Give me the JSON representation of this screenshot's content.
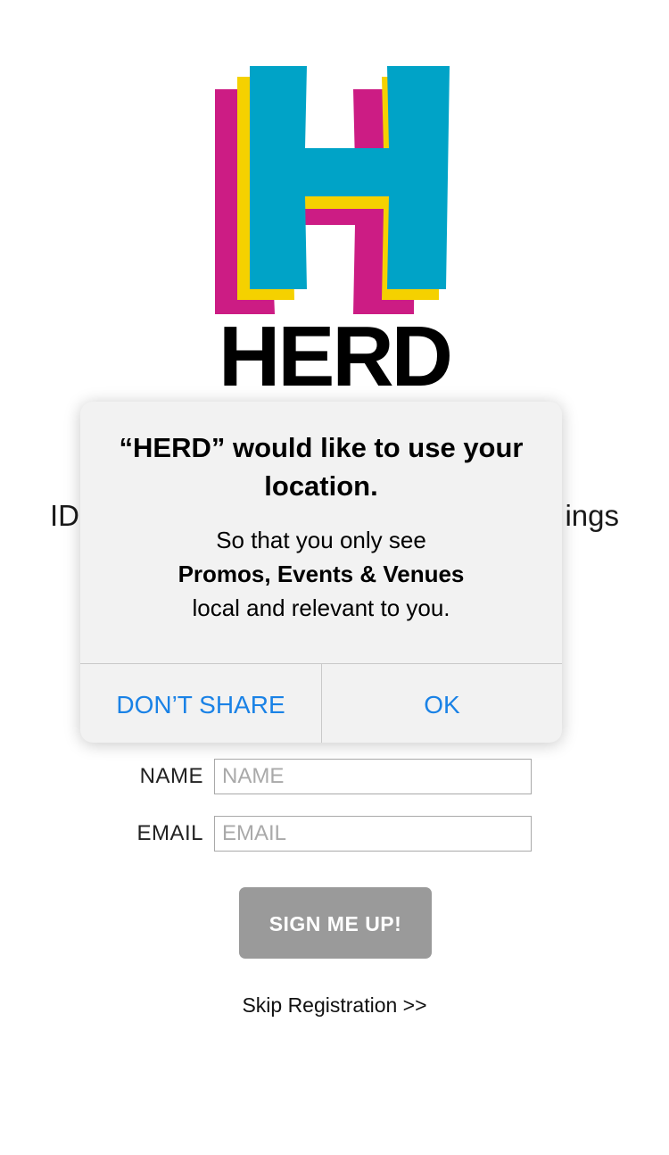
{
  "app": {
    "wordmark": "HERD",
    "logo_icon": "herd-h-logo",
    "brand_colors": {
      "magenta": "#cc1c84",
      "yellow": "#f5d100",
      "cyan": "#00a3c7"
    }
  },
  "tagline": {
    "left_fragment": "ID",
    "right_fragment": "ings"
  },
  "form": {
    "name_label": "NAME",
    "name_placeholder": "NAME",
    "name_value": "",
    "email_label": "EMAIL",
    "email_placeholder": "EMAIL",
    "email_value": "",
    "signup_label": "SIGN ME UP!",
    "signup_color": "#9a9a9a",
    "skip_label": "Skip Registration >>"
  },
  "alert": {
    "title": "“HERD” would like to use your location.",
    "message_line1": "So that you only see",
    "message_bold": "Promos, Events & Venues",
    "message_line3": "local and relevant to you.",
    "deny_label": "DON’T SHARE",
    "allow_label": "OK",
    "button_color": "#1a82e6"
  }
}
